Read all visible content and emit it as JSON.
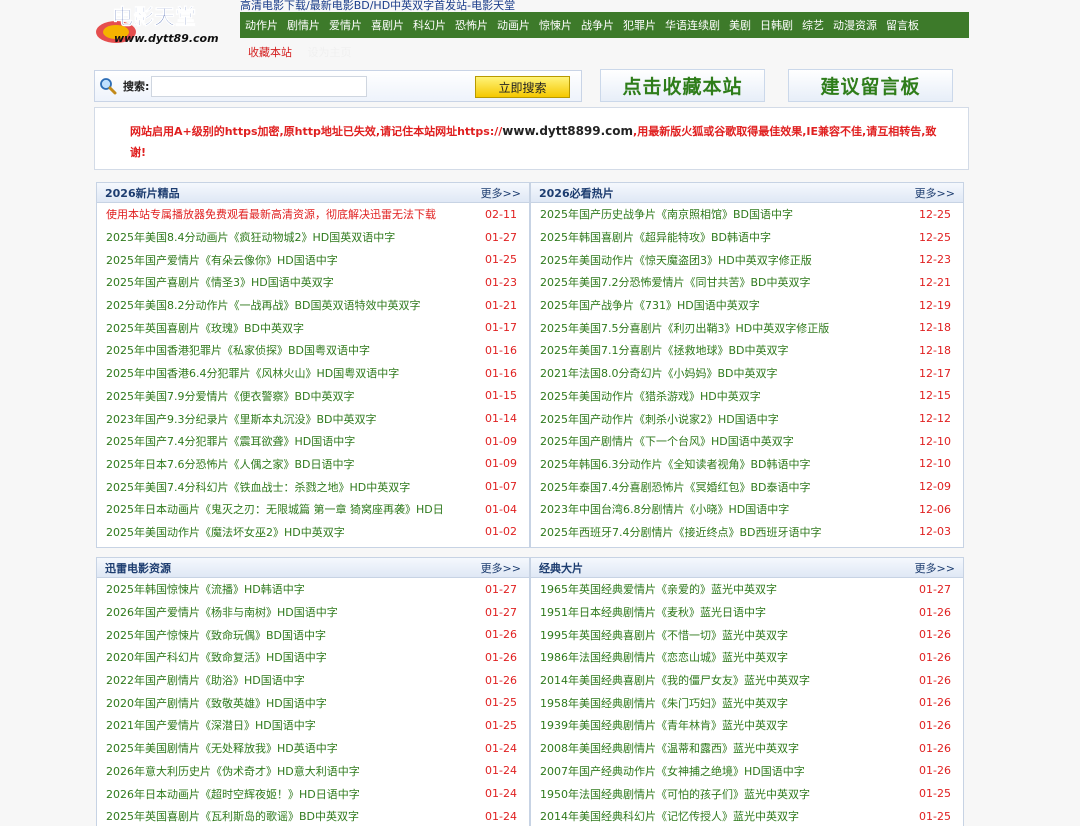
{
  "site": {
    "logo_cn": "电影天堂",
    "logo_url": "www.dytt89.com",
    "top_title": "高清电影下载/最新电影BD/HD中英双字首发站-电影天堂"
  },
  "nav": [
    "动作片",
    "剧情片",
    "爱情片",
    "喜剧片",
    "科幻片",
    "恐怖片",
    "动画片",
    "惊悚片",
    "战争片",
    "犯罪片",
    "华语连续剧",
    "美剧",
    "日韩剧",
    "综艺",
    "动漫资源",
    "留言板"
  ],
  "subnav": {
    "bookmark": "收藏本站",
    "hidden": "设为主页"
  },
  "search": {
    "label": "搜索:",
    "placeholder": "",
    "value": "",
    "button": "立即搜索"
  },
  "big_buttons": {
    "bookmark": "点击收藏本站",
    "message": "建议留言板"
  },
  "notice": {
    "text1": "网站启用A+级别的https加密,原http地址已失效,请记住本站网址https://",
    "url": "www.dytt8899.com",
    "text2": ",用最新版火狐或谷歌取得最佳效果,IE兼容不佳,请互相转告,致谢!"
  },
  "colors": {
    "nav_bg": "#3d7a2a",
    "link_green": "#2f7a1c",
    "date_red": "#e02020",
    "header_blue": "#1d3d70"
  },
  "boxes": [
    {
      "title": "2026新片精品",
      "more": "更多>>",
      "items": [
        {
          "text": "使用本站专属播放器免费观看最新高清资源，彻底解决迅雷无法下载",
          "date": "02-11"
        },
        {
          "text": "2025年美国8.4分动画片《疯狂动物城2》HD国英双语中字",
          "date": "01-27"
        },
        {
          "text": "2025年国产爱情片《有朵云像你》HD国语中字",
          "date": "01-25"
        },
        {
          "text": "2025年国产喜剧片《情圣3》HD国语中英双字",
          "date": "01-23"
        },
        {
          "text": "2025年美国8.2分动作片《一战再战》BD国英双语特效中英双字",
          "date": "01-21"
        },
        {
          "text": "2025年英国喜剧片《玫瑰》BD中英双字",
          "date": "01-17"
        },
        {
          "text": "2025年中国香港犯罪片《私家侦探》BD国粤双语中字",
          "date": "01-16"
        },
        {
          "text": "2025年中国香港6.4分犯罪片《风林火山》HD国粤双语中字",
          "date": "01-16"
        },
        {
          "text": "2025年美国7.9分爱情片《便衣警察》BD中英双字",
          "date": "01-15"
        },
        {
          "text": "2023年国产9.3分纪录片《里斯本丸沉没》BD中英双字",
          "date": "01-14"
        },
        {
          "text": "2025年国产7.4分犯罪片《震耳欲聋》HD国语中字",
          "date": "01-09"
        },
        {
          "text": "2025年日本7.6分恐怖片《人偶之家》BD日语中字",
          "date": "01-09"
        },
        {
          "text": "2025年美国7.4分科幻片《铁血战士：杀戮之地》HD中英双字",
          "date": "01-07"
        },
        {
          "text": "2025年日本动画片《鬼灭之刃：无限城篇 第一章 猗窝座再袭》HD日",
          "date": "01-04"
        },
        {
          "text": "2025年美国动作片《魔法坏女巫2》HD中英双字",
          "date": "01-02"
        }
      ]
    },
    {
      "title": "2026必看热片",
      "more": "更多>>",
      "items": [
        {
          "text": "2025年国产历史战争片《南京照相馆》BD国语中字",
          "date": "12-25"
        },
        {
          "text": "2025年韩国喜剧片《超异能特攻》BD韩语中字",
          "date": "12-25"
        },
        {
          "text": "2025年美国动作片《惊天魔盗团3》HD中英双字修正版",
          "date": "12-23"
        },
        {
          "text": "2025年美国7.2分恐怖爱情片《同甘共苦》BD中英双字",
          "date": "12-21"
        },
        {
          "text": "2025年国产战争片《731》HD国语中英双字",
          "date": "12-19"
        },
        {
          "text": "2025年美国7.5分喜剧片《利刃出鞘3》HD中英双字修正版",
          "date": "12-18"
        },
        {
          "text": "2025年美国7.1分喜剧片《拯救地球》BD中英双字",
          "date": "12-18"
        },
        {
          "text": "2021年法国8.0分奇幻片《小妈妈》BD中英双字",
          "date": "12-17"
        },
        {
          "text": "2025年美国动作片《猎杀游戏》HD中英双字",
          "date": "12-15"
        },
        {
          "text": "2025年国产动作片《刺杀小说家2》HD国语中字",
          "date": "12-12"
        },
        {
          "text": "2025年国产剧情片《下一个台风》HD国语中英双字",
          "date": "12-10"
        },
        {
          "text": "2025年韩国6.3分动作片《全知读者视角》BD韩语中字",
          "date": "12-10"
        },
        {
          "text": "2025年泰国7.4分喜剧恐怖片《冥婚红包》BD泰语中字",
          "date": "12-09"
        },
        {
          "text": "2023年中国台湾6.8分剧情片《小晓》HD国语中字",
          "date": "12-06"
        },
        {
          "text": "2025年西班牙7.4分剧情片《接近终点》BD西班牙语中字",
          "date": "12-03"
        }
      ]
    },
    {
      "title": "迅雷电影资源",
      "more": "更多>>",
      "items": [
        {
          "text": "2025年韩国惊悚片《流播》HD韩语中字",
          "date": "01-27"
        },
        {
          "text": "2026年国产爱情片《杨非与南树》HD国语中字",
          "date": "01-27"
        },
        {
          "text": "2025年国产惊悚片《致命玩偶》BD国语中字",
          "date": "01-26"
        },
        {
          "text": "2020年国产科幻片《致命复活》HD国语中字",
          "date": "01-26"
        },
        {
          "text": "2022年国产剧情片《助浴》HD国语中字",
          "date": "01-26"
        },
        {
          "text": "2020年国产剧情片《致敬英雄》HD国语中字",
          "date": "01-25"
        },
        {
          "text": "2021年国产爱情片《深潜日》HD国语中字",
          "date": "01-25"
        },
        {
          "text": "2025年美国剧情片《无处释放我》HD英语中字",
          "date": "01-24"
        },
        {
          "text": "2026年意大利历史片《伪术奇才》HD意大利语中字",
          "date": "01-24"
        },
        {
          "text": "2026年日本动画片《超时空辉夜姬！》HD日语中字",
          "date": "01-24"
        },
        {
          "text": "2025年英国喜剧片《瓦利斯岛的歌谣》BD中英双字",
          "date": "01-24"
        }
      ]
    },
    {
      "title": "经典大片",
      "more": "更多>>",
      "items": [
        {
          "text": "1965年英国经典爱情片《亲爱的》蓝光中英双字",
          "date": "01-27"
        },
        {
          "text": "1951年日本经典剧情片《麦秋》蓝光日语中字",
          "date": "01-26"
        },
        {
          "text": "1995年英国经典喜剧片《不惜一切》蓝光中英双字",
          "date": "01-26"
        },
        {
          "text": "1986年法国经典剧情片《恋恋山城》蓝光中英双字",
          "date": "01-26"
        },
        {
          "text": "2014年美国经典喜剧片《我的僵尸女友》蓝光中英双字",
          "date": "01-26"
        },
        {
          "text": "1958年美国经典剧情片《朱门巧妇》蓝光中英双字",
          "date": "01-26"
        },
        {
          "text": "1939年美国经典剧情片《青年林肯》蓝光中英双字",
          "date": "01-26"
        },
        {
          "text": "2008年美国经典剧情片《温蒂和露西》蓝光中英双字",
          "date": "01-26"
        },
        {
          "text": "2007年国产经典动作片《女神捕之绝境》HD国语中字",
          "date": "01-26"
        },
        {
          "text": "1950年法国经典剧情片《可怕的孩子们》蓝光中英双字",
          "date": "01-25"
        },
        {
          "text": "2014年美国经典科幻片《记忆传授人》蓝光中英双字",
          "date": "01-25"
        }
      ]
    }
  ]
}
